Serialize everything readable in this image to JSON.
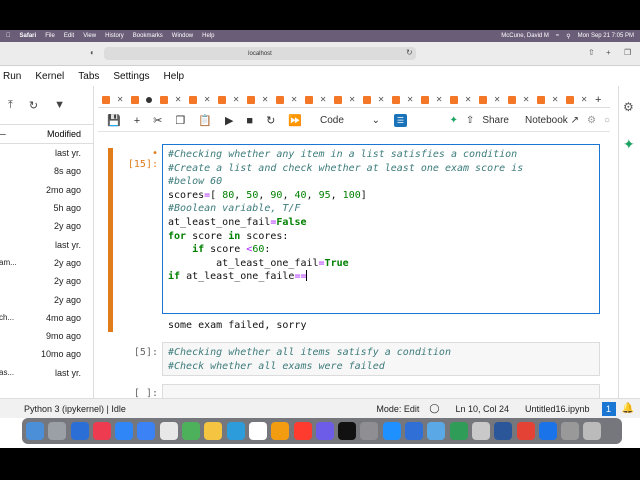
{
  "menubar": {
    "app": "Safari",
    "items": [
      "File",
      "Edit",
      "View",
      "History",
      "Bookmarks",
      "Window",
      "Help"
    ],
    "user": "McCune, David M",
    "clock": "Mon Sep 21 7:05 PM"
  },
  "browser": {
    "url": "localhost"
  },
  "jupyter_menu": [
    "Run",
    "Kernel",
    "Tabs",
    "Settings",
    "Help"
  ],
  "filebrowser": {
    "column_modified": "Modified",
    "rows": [
      {
        "name": "",
        "modified": "last yr."
      },
      {
        "name": "",
        "modified": "8s ago"
      },
      {
        "name": "",
        "modified": "2mo ago"
      },
      {
        "name": "",
        "modified": "5h ago"
      },
      {
        "name": "",
        "modified": "2y ago"
      },
      {
        "name": "",
        "modified": "last yr."
      },
      {
        "name": "am...",
        "modified": "2y ago"
      },
      {
        "name": "",
        "modified": "2y ago"
      },
      {
        "name": "",
        "modified": "2y ago"
      },
      {
        "name": "ch...",
        "modified": "4mo ago"
      },
      {
        "name": "",
        "modified": "9mo ago"
      },
      {
        "name": "",
        "modified": "10mo ago"
      },
      {
        "name": "as...",
        "modified": "last yr."
      }
    ]
  },
  "toolbar": {
    "cell_type": "Code",
    "share": "Share",
    "kernel_label": "Notebook"
  },
  "cells": [
    {
      "prompt": "[15]:",
      "prompt_marker": "•",
      "output": "some exam failed, sorry"
    },
    {
      "prompt": "[5]:",
      "line1": "#Checking whether all items satisfy a condition",
      "line2": "#Check whether all exams were failed"
    },
    {
      "prompt": "[ ]:"
    }
  ],
  "status": {
    "kernel": "Python 3 (ipykernel) | Idle",
    "mode": "Mode: Edit",
    "position": "Ln 10, Col 24",
    "file": "Untitled16.ipynb",
    "notifications": "1"
  },
  "colors": {
    "accent": "#1976d2",
    "jupyter_orange": "#f37726",
    "collapser": "#e07c1a"
  }
}
